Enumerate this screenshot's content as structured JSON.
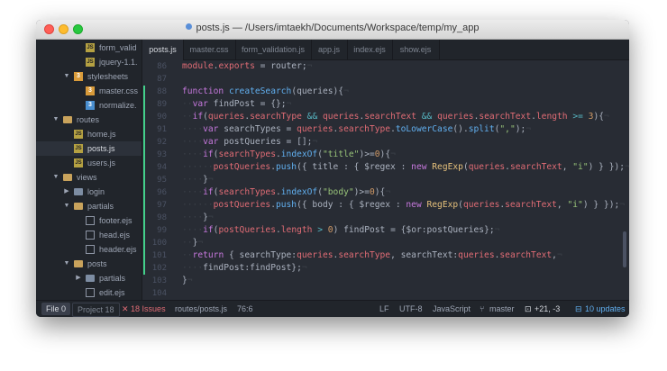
{
  "window": {
    "title": "posts.js — /Users/imtaekh/Documents/Workspace/temp/my_app"
  },
  "tree": [
    {
      "label": "form_valid",
      "icon": "js",
      "indent": 55,
      "chev": ""
    },
    {
      "label": "jquery-1.1.",
      "icon": "js",
      "indent": 55,
      "chev": ""
    },
    {
      "label": "stylesheets",
      "icon": "css-orange",
      "indent": 42,
      "chev": "open"
    },
    {
      "label": "master.css",
      "icon": "css-orange",
      "indent": 55,
      "chev": ""
    },
    {
      "label": "normalize.",
      "icon": "css",
      "indent": 55,
      "chev": ""
    },
    {
      "label": "routes",
      "icon": "folder-open",
      "indent": 30,
      "chev": "open"
    },
    {
      "label": "home.js",
      "icon": "js",
      "indent": 42,
      "chev": ""
    },
    {
      "label": "posts.js",
      "icon": "js",
      "indent": 42,
      "chev": "",
      "selected": true
    },
    {
      "label": "users.js",
      "icon": "js",
      "indent": 42,
      "chev": ""
    },
    {
      "label": "views",
      "icon": "folder-open",
      "indent": 30,
      "chev": "open"
    },
    {
      "label": "login",
      "icon": "folder",
      "indent": 42,
      "chev": "closed"
    },
    {
      "label": "partials",
      "icon": "folder-open",
      "indent": 42,
      "chev": "open"
    },
    {
      "label": "footer.ejs",
      "icon": "file",
      "indent": 55,
      "chev": ""
    },
    {
      "label": "head.ejs",
      "icon": "file",
      "indent": 55,
      "chev": ""
    },
    {
      "label": "header.ejs",
      "icon": "file",
      "indent": 55,
      "chev": ""
    },
    {
      "label": "posts",
      "icon": "folder-open",
      "indent": 42,
      "chev": "open"
    },
    {
      "label": "partials",
      "icon": "folder",
      "indent": 55,
      "chev": "closed"
    },
    {
      "label": "edit.ejs",
      "icon": "file",
      "indent": 55,
      "chev": ""
    }
  ],
  "tabs": [
    {
      "label": "posts.js",
      "active": true
    },
    {
      "label": "master.css"
    },
    {
      "label": "form_validation.js"
    },
    {
      "label": "app.js"
    },
    {
      "label": "index.ejs"
    },
    {
      "label": "show.ejs"
    }
  ],
  "line_numbers": [
    "86",
    "87",
    "88",
    "89",
    "90",
    "91",
    "92",
    "93",
    "94",
    "95",
    "96",
    "97",
    "98",
    "99",
    "100",
    "101",
    "102",
    "103",
    "104"
  ],
  "code_lines": [
    [
      [
        "var",
        "module"
      ],
      [
        "",
        "."
      ],
      [
        "var",
        "exports"
      ],
      [
        "",
        " = router;"
      ],
      [
        "inv",
        "¬"
      ]
    ],
    [
      [
        "inv",
        ""
      ]
    ],
    [
      [
        "kw",
        "function"
      ],
      [
        "",
        " "
      ],
      [
        "fn",
        "createSearch"
      ],
      [
        "",
        "(queries){"
      ],
      [
        "inv",
        "¬"
      ]
    ],
    [
      [
        "inv",
        "··"
      ],
      [
        "kw",
        "var"
      ],
      [
        "",
        " findPost = {};"
      ],
      [
        "inv",
        "¬"
      ]
    ],
    [
      [
        "inv",
        "··"
      ],
      [
        "kw",
        "if"
      ],
      [
        "",
        "("
      ],
      [
        "var",
        "queries"
      ],
      [
        "",
        "."
      ],
      [
        "var",
        "searchType"
      ],
      [
        "",
        " "
      ],
      [
        "op",
        "&&"
      ],
      [
        "",
        " "
      ],
      [
        "var",
        "queries"
      ],
      [
        "",
        "."
      ],
      [
        "var",
        "searchText"
      ],
      [
        "",
        " "
      ],
      [
        "op",
        "&&"
      ],
      [
        "",
        " "
      ],
      [
        "var",
        "queries"
      ],
      [
        "",
        "."
      ],
      [
        "var",
        "searchText"
      ],
      [
        "",
        "."
      ],
      [
        "var",
        "length"
      ],
      [
        "",
        " "
      ],
      [
        "op",
        ">="
      ],
      [
        "",
        " "
      ],
      [
        "num",
        "3"
      ],
      [
        "",
        "){"
      ],
      [
        "inv",
        "¬"
      ]
    ],
    [
      [
        "inv",
        "····"
      ],
      [
        "kw",
        "var"
      ],
      [
        "",
        " searchTypes = "
      ],
      [
        "var",
        "queries"
      ],
      [
        "",
        "."
      ],
      [
        "var",
        "searchType"
      ],
      [
        "",
        "."
      ],
      [
        "fn",
        "toLowerCase"
      ],
      [
        "",
        "()."
      ],
      [
        "fn",
        "split"
      ],
      [
        "",
        "("
      ],
      [
        "str",
        "\",\""
      ],
      [
        "",
        ");"
      ],
      [
        "inv",
        "¬"
      ]
    ],
    [
      [
        "inv",
        "····"
      ],
      [
        "kw",
        "var"
      ],
      [
        "",
        " postQueries = [];"
      ],
      [
        "inv",
        "¬"
      ]
    ],
    [
      [
        "inv",
        "····"
      ],
      [
        "kw",
        "if"
      ],
      [
        "",
        "("
      ],
      [
        "var",
        "searchTypes"
      ],
      [
        "",
        "."
      ],
      [
        "fn",
        "indexOf"
      ],
      [
        "",
        "("
      ],
      [
        "str",
        "\"title\""
      ],
      [
        "",
        ")>="
      ],
      [
        "num",
        "0"
      ],
      [
        "",
        "){"
      ],
      [
        "inv",
        "¬"
      ]
    ],
    [
      [
        "inv",
        "······"
      ],
      [
        "var",
        "postQueries"
      ],
      [
        "",
        "."
      ],
      [
        "fn",
        "push"
      ],
      [
        "",
        "({ title : { $regex : "
      ],
      [
        "kw",
        "new"
      ],
      [
        "",
        " "
      ],
      [
        "cls",
        "RegExp"
      ],
      [
        "",
        "("
      ],
      [
        "var",
        "queries"
      ],
      [
        "",
        "."
      ],
      [
        "var",
        "searchText"
      ],
      [
        "",
        ", "
      ],
      [
        "str",
        "\"i\""
      ],
      [
        "",
        ") } });"
      ],
      [
        "inv",
        "¬"
      ]
    ],
    [
      [
        "inv",
        "····"
      ],
      [
        "",
        "}"
      ],
      [
        "inv",
        "¬"
      ]
    ],
    [
      [
        "inv",
        "····"
      ],
      [
        "kw",
        "if"
      ],
      [
        "",
        "("
      ],
      [
        "var",
        "searchTypes"
      ],
      [
        "",
        "."
      ],
      [
        "fn",
        "indexOf"
      ],
      [
        "",
        "("
      ],
      [
        "str",
        "\"body\""
      ],
      [
        "",
        ")>="
      ],
      [
        "num",
        "0"
      ],
      [
        "",
        "){"
      ],
      [
        "inv",
        "¬"
      ]
    ],
    [
      [
        "inv",
        "······"
      ],
      [
        "var",
        "postQueries"
      ],
      [
        "",
        "."
      ],
      [
        "fn",
        "push"
      ],
      [
        "",
        "({ body : { $regex : "
      ],
      [
        "kw",
        "new"
      ],
      [
        "",
        " "
      ],
      [
        "cls",
        "RegExp"
      ],
      [
        "",
        "("
      ],
      [
        "var",
        "queries"
      ],
      [
        "",
        "."
      ],
      [
        "var",
        "searchText"
      ],
      [
        "",
        ", "
      ],
      [
        "str",
        "\"i\""
      ],
      [
        "",
        ") } });"
      ],
      [
        "inv",
        "¬"
      ]
    ],
    [
      [
        "inv",
        "····"
      ],
      [
        "",
        "}"
      ],
      [
        "inv",
        "¬"
      ]
    ],
    [
      [
        "inv",
        "····"
      ],
      [
        "kw",
        "if"
      ],
      [
        "",
        "("
      ],
      [
        "var",
        "postQueries"
      ],
      [
        "",
        "."
      ],
      [
        "var",
        "length"
      ],
      [
        "",
        " "
      ],
      [
        "op",
        ">"
      ],
      [
        "",
        " "
      ],
      [
        "num",
        "0"
      ],
      [
        "",
        ") findPost = {$or:postQueries};"
      ],
      [
        "inv",
        "¬"
      ]
    ],
    [
      [
        "inv",
        "··"
      ],
      [
        "",
        "}"
      ],
      [
        "inv",
        "¬"
      ]
    ],
    [
      [
        "inv",
        "··"
      ],
      [
        "kw",
        "return"
      ],
      [
        "",
        " { searchType:"
      ],
      [
        "var",
        "queries"
      ],
      [
        "",
        "."
      ],
      [
        "var",
        "searchType"
      ],
      [
        "",
        ", searchText:"
      ],
      [
        "var",
        "queries"
      ],
      [
        "",
        "."
      ],
      [
        "var",
        "searchText"
      ],
      [
        "",
        ","
      ],
      [
        "inv",
        "¬"
      ]
    ],
    [
      [
        "inv",
        "····"
      ],
      [
        "",
        "findPost:findPost};"
      ],
      [
        "inv",
        "¬"
      ]
    ],
    [
      [
        "",
        "}"
      ],
      [
        "inv",
        "¬"
      ]
    ],
    [
      [
        "inv",
        ""
      ]
    ]
  ],
  "status": {
    "file_btn": "File 0",
    "project_btn": "Project 18",
    "issues": "✕  18 Issues",
    "path": "routes/posts.js",
    "cursor": "76:6",
    "line_ending": "LF",
    "encoding": "UTF-8",
    "grammar": "JavaScript",
    "branch": "master",
    "diff": "+21, -3",
    "updates": "10 updates"
  }
}
